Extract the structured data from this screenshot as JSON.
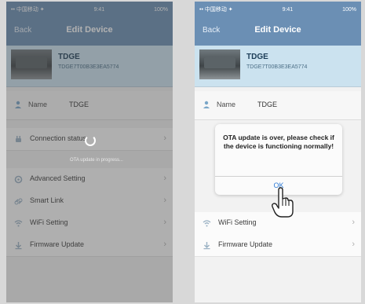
{
  "left_screen": {
    "status": {
      "carrier": "•• 中国移动 ✦",
      "time": "9:41",
      "battery": "100%"
    },
    "nav": {
      "back": "Back",
      "title": "Edit Device"
    },
    "device": {
      "name": "TDGE",
      "uid": "TDGE7T00B3E3EA5774"
    },
    "name_row": {
      "label": "Name",
      "value": "TDGE"
    },
    "menu": [
      {
        "label": "Connection status",
        "icon": "plug-icon"
      },
      {
        "label": "Advanced Setting",
        "icon": "settings-icon"
      },
      {
        "label": "Smart Link",
        "icon": "link-icon"
      },
      {
        "label": "WiFi Setting",
        "icon": "wifi-icon"
      },
      {
        "label": "Firmware Update",
        "icon": "update-icon"
      }
    ],
    "overlay": {
      "progress_text": "OTA update in progress..."
    }
  },
  "right_screen": {
    "status": {
      "carrier": "•• 中国移动 ✦",
      "time": "9:41",
      "battery": "100%"
    },
    "nav": {
      "back": "Back",
      "title": "Edit Device"
    },
    "device": {
      "name": "TDGE",
      "uid": "TDGE7T00B3E3EA5774"
    },
    "name_row": {
      "label": "Name",
      "value": "TDGE"
    },
    "menu": [
      {
        "label": "WiFi Setting",
        "icon": "wifi-icon"
      },
      {
        "label": "Firmware Update",
        "icon": "update-icon"
      }
    ],
    "alert": {
      "message": "OTA update is over, please check if the device is functioning normally!",
      "button": "OK"
    }
  },
  "colors": {
    "nav": "#6b8fb4",
    "accent": "#2d7ad6",
    "card": "#cbe2ef"
  }
}
